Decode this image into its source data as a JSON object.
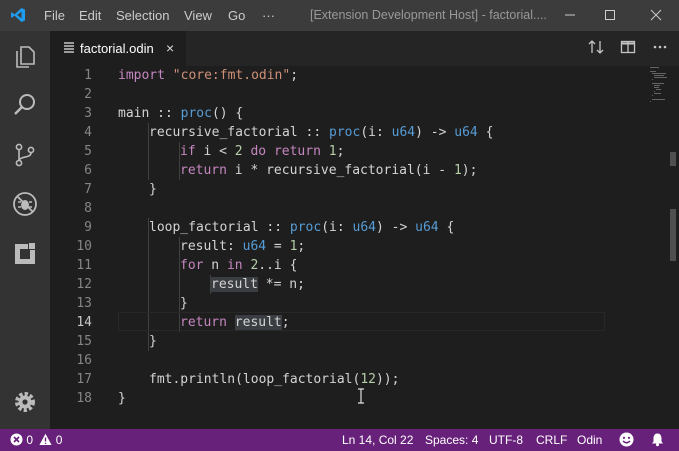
{
  "titlebar": {
    "menus": [
      "File",
      "Edit",
      "Selection",
      "View",
      "Go",
      "···"
    ],
    "window_title": "[Extension Development Host] - factorial...."
  },
  "tab": {
    "label": "factorial.odin",
    "close": "×"
  },
  "editor": {
    "active_line": 14,
    "lines": [
      {
        "n": "1"
      },
      {
        "n": "2"
      },
      {
        "n": "3"
      },
      {
        "n": "4"
      },
      {
        "n": "5"
      },
      {
        "n": "6"
      },
      {
        "n": "7"
      },
      {
        "n": "8"
      },
      {
        "n": "9"
      },
      {
        "n": "10"
      },
      {
        "n": "11"
      },
      {
        "n": "12"
      },
      {
        "n": "13"
      },
      {
        "n": "14"
      },
      {
        "n": "15"
      },
      {
        "n": "16"
      },
      {
        "n": "17"
      },
      {
        "n": "18"
      }
    ],
    "tokens": {
      "l1_import": "import",
      "l1_str": "\"core:fmt.odin\"",
      "l1_semi": ";",
      "l3_main": "main :: ",
      "l3_proc": "proc",
      "l3_rest": "() {",
      "l4_name": "recursive_factorial :: ",
      "l4_proc": "proc",
      "l4_a": "(i: ",
      "l4_u64a": "u64",
      "l4_b": ") -> ",
      "l4_u64b": "u64",
      "l4_c": " {",
      "l5_if": "if",
      "l5_a": " i < ",
      "l5_2": "2",
      "l5_sp": " ",
      "l5_do": "do",
      "l5_sp2": " ",
      "l5_ret": "return",
      "l5_sp3": " ",
      "l5_1": "1",
      "l5_semi": ";",
      "l6_ret": "return",
      "l6_a": " i * recursive_factorial(i - ",
      "l6_1": "1",
      "l6_b": ");",
      "l7_close": "}",
      "l9_name": "loop_factorial :: ",
      "l9_proc": "proc",
      "l9_a": "(i: ",
      "l9_u64a": "u64",
      "l9_b": ") -> ",
      "l9_u64b": "u64",
      "l9_c": " {",
      "l10_a": "result: ",
      "l10_u64": "u64",
      "l10_b": " = ",
      "l10_1": "1",
      "l10_semi": ";",
      "l11_for": "for",
      "l11_a": " n ",
      "l11_in": "in",
      "l11_sp": " ",
      "l11_2": "2",
      "l11_b": "..i {",
      "l12_result": "result",
      "l12_rest": " *= n;",
      "l13_close": "}",
      "l14_ret": "return",
      "l14_sp": " ",
      "l14_result": "result",
      "l14_semi": ";",
      "l15_close": "}",
      "l17_a": "fmt.println(loop_factorial(",
      "l17_12": "12",
      "l17_b": "));",
      "l18_close": "}"
    }
  },
  "statusbar": {
    "errors": "0",
    "warnings": "0",
    "position": "Ln 14, Col 22",
    "spaces": "Spaces: 4",
    "encoding": "UTF-8",
    "eol": "CRLF",
    "language": "Odin"
  },
  "icons": {
    "app": "vscode-logo-icon",
    "explorer": "files-icon",
    "search": "search-icon",
    "scm": "source-control-icon",
    "debug": "debug-icon",
    "extensions": "extensions-icon",
    "settings": "gear-icon",
    "feedback": "smiley-icon",
    "bell": "bell-icon"
  },
  "colors": {
    "statusbar": "#68217a",
    "keyword": "#c586c0",
    "string": "#ce9178",
    "type": "#569cd6",
    "number": "#b5cea8",
    "logo": "#1f9cf0"
  }
}
